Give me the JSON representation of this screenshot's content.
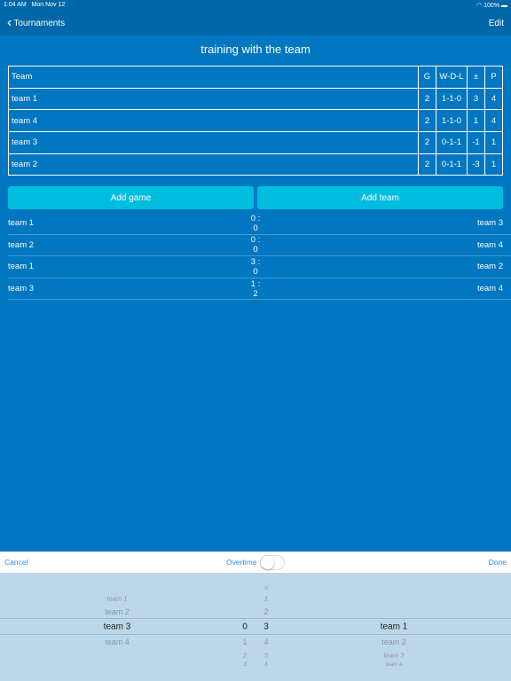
{
  "status": {
    "time": "1:04 AM",
    "date": "Mon Nov 12",
    "battery": "100%"
  },
  "nav": {
    "back_label": "Tournaments",
    "edit_label": "Edit"
  },
  "title": "training with the team",
  "standings": {
    "headers": [
      "Team",
      "G",
      "W-D-L",
      "±",
      "P"
    ],
    "rows": [
      [
        "team 1",
        "2",
        "1-1-0",
        "3",
        "4"
      ],
      [
        "team 4",
        "2",
        "1-1-0",
        "1",
        "4"
      ],
      [
        "team 3",
        "2",
        "0-1-1",
        "-1",
        "1"
      ],
      [
        "team 2",
        "2",
        "0-1-1",
        "-3",
        "1"
      ]
    ]
  },
  "buttons": {
    "add_game": "Add game",
    "add_team": "Add team"
  },
  "games": [
    {
      "home": "team 1",
      "score": "0 : 0",
      "away": "team 3"
    },
    {
      "home": "team 2",
      "score": "0 : 0",
      "away": "team 4"
    },
    {
      "home": "team 1",
      "score": "3 : 0",
      "away": "team 2"
    },
    {
      "home": "team 3",
      "score": "1 : 2",
      "away": "team 4"
    }
  ],
  "toolbar": {
    "cancel": "Cancel",
    "overtime": "Overtime",
    "overtime_on": false,
    "done": "Done"
  },
  "picker": {
    "home_team": {
      "items": [
        "team 1",
        "team 2",
        "team 3",
        "team 4"
      ],
      "selected": "team 3"
    },
    "home_score": {
      "items": [
        "0",
        "1",
        "2",
        "3"
      ],
      "selected": "0"
    },
    "away_score": {
      "items": [
        "0",
        "1",
        "2",
        "3",
        "4",
        "5",
        "6"
      ],
      "selected": "3"
    },
    "away_team": {
      "items": [
        "team 1",
        "team 2",
        "team 3",
        "team 4"
      ],
      "selected": "team 1"
    }
  }
}
